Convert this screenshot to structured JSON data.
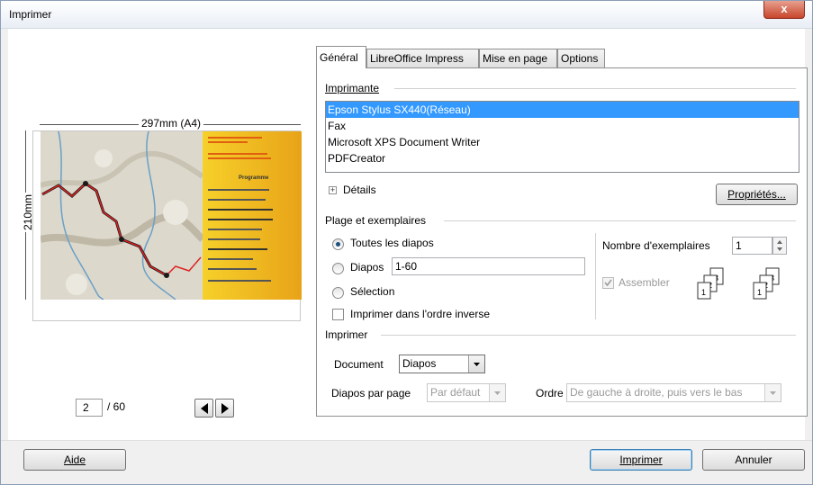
{
  "window": {
    "title": "Imprimer",
    "close_symbol": "x"
  },
  "preview": {
    "width_label": "297mm (A4)",
    "height_label": "210mm",
    "slide_title": "Programme",
    "current_page": "2",
    "total_pages": "/ 60"
  },
  "tabs": [
    {
      "label": "Général"
    },
    {
      "label": "LibreOffice Impress"
    },
    {
      "label": "Mise en page"
    },
    {
      "label": "Options"
    }
  ],
  "printer": {
    "section_title": "Imprimante",
    "items": [
      {
        "label": "Epson Stylus SX440(Réseau)"
      },
      {
        "label": "Fax"
      },
      {
        "label": "Microsoft XPS Document Writer"
      },
      {
        "label": "PDFCreator"
      }
    ],
    "details_label": "Détails",
    "properties_label": "Propriétés..."
  },
  "range": {
    "section_title": "Plage et exemplaires",
    "all_label": "Toutes les diapos",
    "slides_label": "Diapos",
    "slides_value": "1-60",
    "selection_label": "Sélection",
    "reverse_label": "Imprimer dans l'ordre inverse",
    "copies_label": "Nombre d'exemplaires",
    "copies_value": "1",
    "collate_label": "Assembler"
  },
  "print": {
    "section_title": "Imprimer",
    "document_label": "Document",
    "document_value": "Diapos",
    "per_page_label": "Diapos par page",
    "per_page_value": "Par défaut",
    "order_label": "Ordre",
    "order_value": "De gauche à droite, puis vers le bas"
  },
  "footer": {
    "help_label": "Aide",
    "print_label": "Imprimer",
    "cancel_label": "Annuler"
  },
  "colors": {
    "selection": "#3399ff",
    "close_button": "#c8452c",
    "slide_accent": "#f6d02a"
  }
}
